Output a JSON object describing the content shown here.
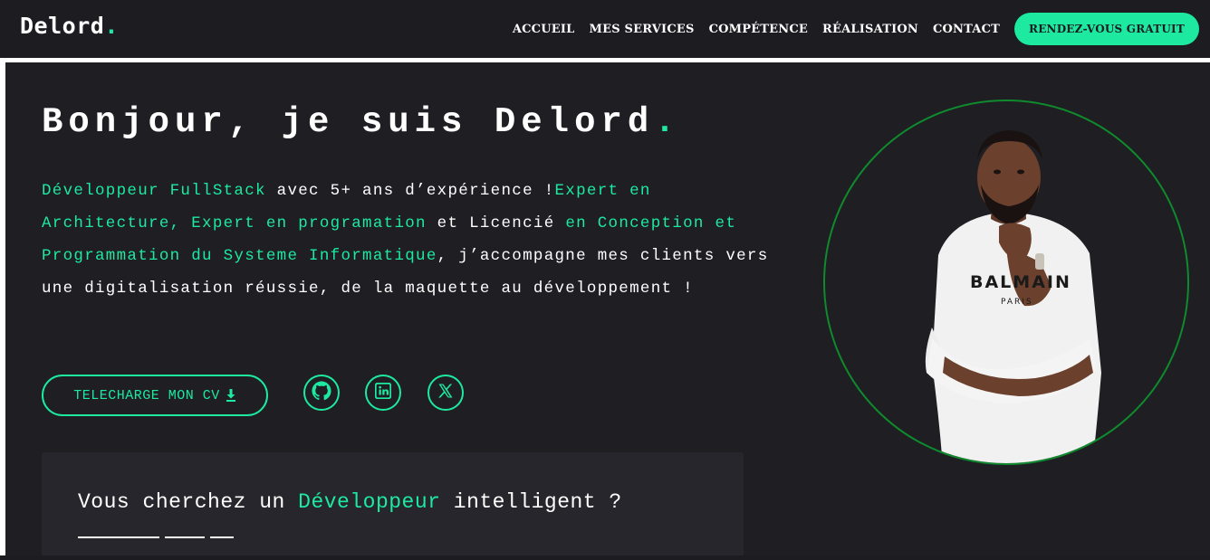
{
  "brand": {
    "name": "Delord",
    "dot": "."
  },
  "nav": {
    "links": [
      "ACCUEIL",
      "MES SERVICES",
      "COMPÉTENCE",
      "RÉALISATION",
      "CONTACT"
    ],
    "cta": "RENDEZ-VOUS GRATUIT"
  },
  "hero": {
    "title": "Bonjour, je suis Delord",
    "title_dot": ".",
    "intro": [
      {
        "text": "Développeur FullStack",
        "highlight": true
      },
      {
        "text": " avec 5+ ans d’expérience !",
        "highlight": false
      },
      {
        "text": "Expert en Architecture, Expert en programation",
        "highlight": true
      },
      {
        "text": " et Licencié ",
        "highlight": false
      },
      {
        "text": "en Conception et Programmation du Systeme Informatique",
        "highlight": true
      },
      {
        "text": ", j’accompagne mes clients vers une digitalisation réussie, de la maquette au développement !",
        "highlight": false
      }
    ],
    "cv_button": "TELECHARGE MON CV",
    "socials": [
      "github-icon",
      "linkedin-icon",
      "x-icon"
    ],
    "portrait_shirt_text": "BALMAIN",
    "portrait_shirt_subtext": "PARIS"
  },
  "card": {
    "before": "Vous cherchez un ",
    "highlight": "Développeur",
    "after": " intelligent ?"
  },
  "colors": {
    "accent": "#1de9a0",
    "background": "#1e1e23",
    "navbar": "#1c1c21",
    "card": "#26262c",
    "ring": "#0f8a2c"
  }
}
